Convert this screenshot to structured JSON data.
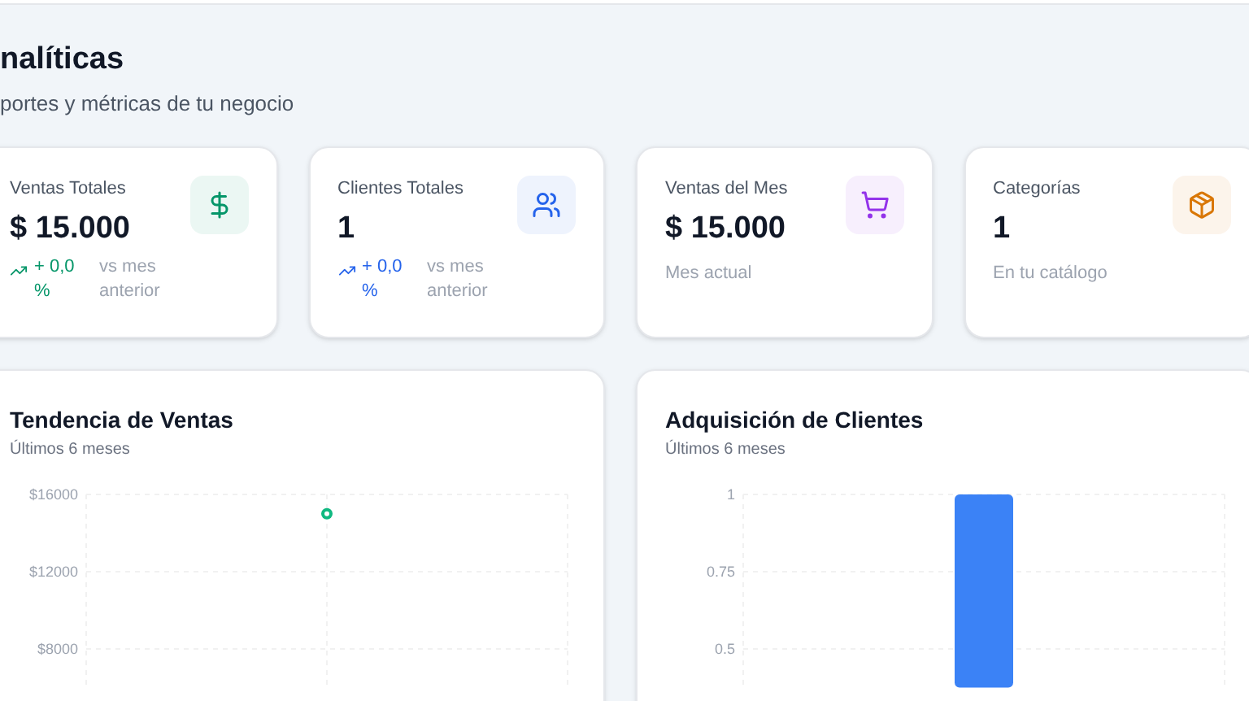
{
  "header": {
    "title": "nalíticas",
    "subtitle": "portes y métricas de tu negocio"
  },
  "stats": [
    {
      "kind": "trend",
      "label": "Ventas Totales",
      "value": "$ 15.000",
      "color": "#059669",
      "change": "+ 0,0 %",
      "note": "vs mes anterior"
    },
    {
      "kind": "trend",
      "label": "Clientes Totales",
      "value": "1",
      "color": "#2563eb",
      "change": "+ 0,0 %",
      "note": "vs mes anterior"
    },
    {
      "kind": "note",
      "label": "Ventas del Mes",
      "value": "$ 15.000",
      "color": "#9333ea",
      "note": "Mes actual"
    },
    {
      "kind": "note",
      "label": "Categorías",
      "value": "1",
      "color": "#d97706",
      "note": "En tu catálogo"
    }
  ],
  "charts": [
    {
      "title": "Tendencia de Ventas",
      "subtitle": "Últimos 6 meses",
      "chart_data": {
        "type": "line",
        "yticks": [
          {
            "value": 16000,
            "label": "$16000"
          },
          {
            "value": 12000,
            "label": "$12000"
          },
          {
            "value": 8000,
            "label": "$8000"
          }
        ],
        "ylim": [
          6000,
          16000
        ],
        "grid": true,
        "series": [
          {
            "color": "#10b981",
            "marker": "circle",
            "values": [
              null,
              15000,
              null
            ]
          }
        ]
      }
    },
    {
      "title": "Adquisición de Clientes",
      "subtitle": "Últimos 6 meses",
      "chart_data": {
        "type": "bar",
        "yticks": [
          {
            "value": 1,
            "label": "1"
          },
          {
            "value": 0.75,
            "label": "0.75"
          },
          {
            "value": 0.5,
            "label": "0.5"
          }
        ],
        "ylim": [
          0.375,
          1
        ],
        "grid": true,
        "series": [
          {
            "color": "#3b82f6",
            "values": [
              1
            ]
          }
        ]
      }
    }
  ]
}
